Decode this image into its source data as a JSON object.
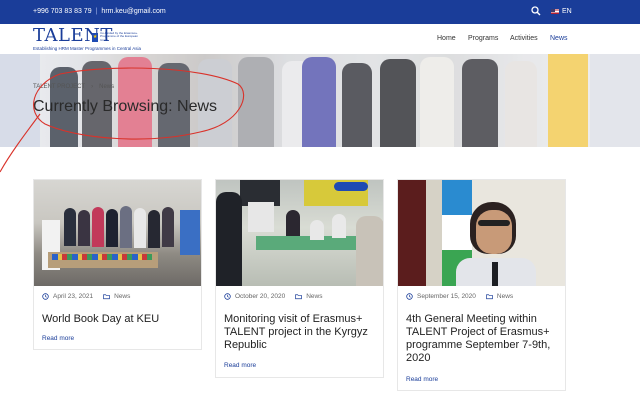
{
  "topbar": {
    "phone": "+996 703 83 83 79",
    "email": "hrm.keu@gmail.com",
    "language": "EN"
  },
  "header": {
    "logo_text": "TALENT",
    "logo_tagline": "Establishing HRM Master Programmes in Central Asia",
    "eu_label": "Co-funded by the Erasmus+ Programme of the European Union",
    "nav": [
      {
        "label": "Home"
      },
      {
        "label": "Programs"
      },
      {
        "label": "Activities"
      },
      {
        "label": "News"
      }
    ]
  },
  "hero": {
    "breadcrumb_home": "TALENT PROJECT",
    "breadcrumb_current": "News",
    "title": "Currently Browsing: News"
  },
  "posts": [
    {
      "date": "April 23, 2021",
      "category": "News",
      "title": "World Book Day at KEU",
      "read_more": "Read more"
    },
    {
      "date": "October 20, 2020",
      "category": "News",
      "title": "Monitoring visit of Erasmus+ TALENT project in the Kyrgyz Republic",
      "read_more": "Read more"
    },
    {
      "date": "September 15, 2020",
      "category": "News",
      "title": "4th General Meeting within TALENT Project of Erasmus+ programme September 7-9th, 2020",
      "read_more": "Read more"
    }
  ],
  "colors": {
    "topbar": "#1a3d99",
    "accent": "#1a3d99",
    "annotation": "#d9322a"
  }
}
